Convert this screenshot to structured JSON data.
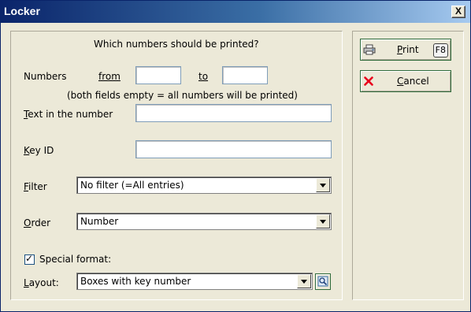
{
  "window": {
    "title": "Locker",
    "close_glyph": "X"
  },
  "form": {
    "heading": "Which numbers should be printed?",
    "numbers_label": "Numbers",
    "from_label": "from",
    "from_value": "",
    "to_label": "to",
    "to_value": "",
    "hint": "(both fields empty = all numbers will be printed)",
    "text_in_number_label": "Text in the number",
    "text_in_number_value": "",
    "key_id_label": "Key ID",
    "key_id_value": "",
    "filter_label": "Filter",
    "filter_value": "No filter (=All entries)",
    "order_label": "Order",
    "order_value": "Number",
    "special_format_label": "Special format:",
    "special_format_checked": true,
    "layout_label": "Layout:",
    "layout_value": "Boxes with key number"
  },
  "buttons": {
    "print_label": "Print",
    "print_shortcut": "F8",
    "cancel_label": "Cancel"
  },
  "colors": {
    "titlebar_start": "#0a246a",
    "button_border": "#2f6b3a",
    "cancel_icon": "#e8001c"
  }
}
